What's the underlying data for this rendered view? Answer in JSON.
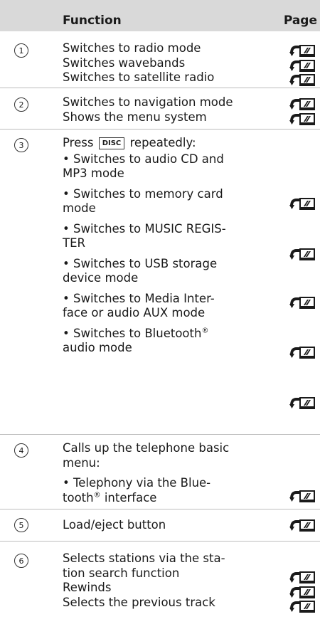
{
  "header": {
    "function": "Function",
    "page": "Page"
  },
  "rows": [
    {
      "num": "1",
      "lines": [
        "Switches to radio mode",
        "Switches wavebands",
        "Switches to satellite radio"
      ]
    },
    {
      "num": "2",
      "lines": [
        "Switches to navigation mode",
        "Shows the menu system"
      ]
    },
    {
      "num": "3",
      "press_prefix": "Press",
      "key": "DISC",
      "press_suffix": "repeatedly:",
      "items": [
        [
          "Switches to audio CD and",
          "MP3 mode"
        ],
        [
          "Switches to memory card",
          "mode"
        ],
        [
          "Switches to MUSIC REGIS-",
          "TER"
        ],
        [
          "Switches to USB storage",
          "device mode"
        ],
        [
          "Switches to Media Inter-",
          "face or audio AUX mode"
        ],
        [
          "Switches to Bluetooth",
          "audio mode"
        ]
      ],
      "reg": "®"
    },
    {
      "num": "4",
      "lines": [
        "Calls up the telephone basic",
        "menu:"
      ],
      "items": [
        [
          "Telephony via the Blue-",
          "tooth",
          " interface"
        ]
      ],
      "reg": "®"
    },
    {
      "num": "5",
      "lines": [
        "Load/eject button"
      ]
    },
    {
      "num": "6",
      "lines": [
        "Selects stations via the sta-",
        "tion search function",
        "Rewinds",
        "Selects the previous track"
      ]
    }
  ],
  "icon": "page-reference-icon"
}
